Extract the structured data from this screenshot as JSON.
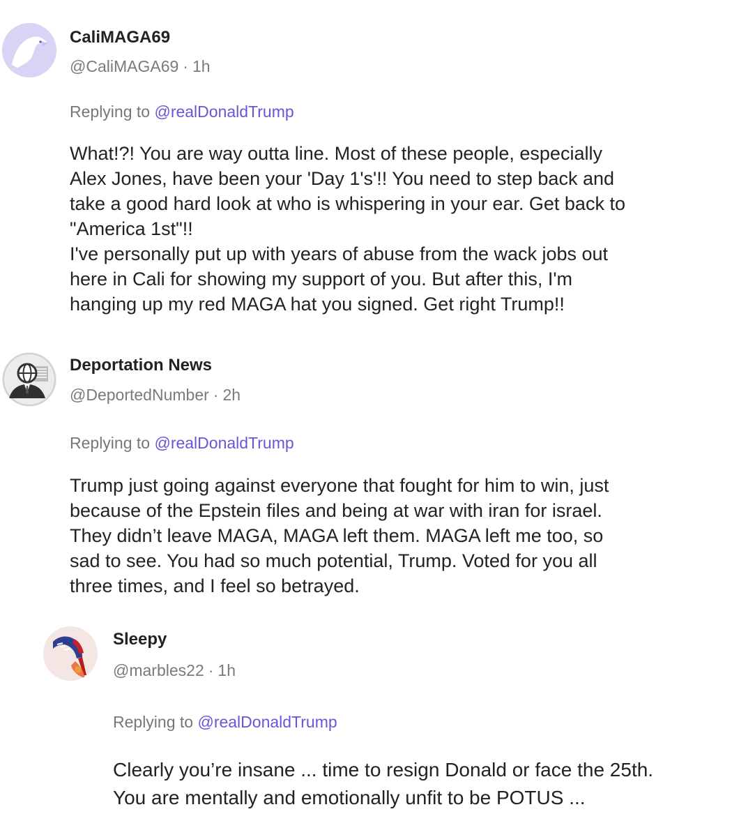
{
  "posts": [
    {
      "display_name": "CaliMAGA69",
      "handle": "@CaliMAGA69",
      "separator": "·",
      "time": "1h",
      "replying_prefix": "Replying to",
      "replying_to": "@realDonaldTrump",
      "avatar_icon": "eagle-avatar-icon",
      "body": "What!?! You are way outta line. Most of these people, especially\nAlex Jones, have been your 'Day 1's'!! You need to step back and\ntake a good hard look at who is whispering in your ear. Get back to\n\"America 1st\"!!\n I've personally put up with years of abuse from the wack jobs out\nhere in Cali for showing my support of you. But after this, I'm\nhanging up my red MAGA hat you signed. Get right Trump!!"
    },
    {
      "display_name": "Deportation News",
      "handle": "@DeportedNumber",
      "separator": "·",
      "time": "2h",
      "replying_prefix": "Replying to",
      "replying_to": "@realDonaldTrump",
      "avatar_icon": "globe-suit-avatar-icon",
      "body": "Trump just going against everyone that fought for him to win, just\nbecause of the Epstein files and being at war with iran for israel.\nThey didn’t leave MAGA, MAGA left them. MAGA left me too, so\nsad to see. You had so much potential, Trump. Voted for you all\nthree times, and I feel so betrayed."
    },
    {
      "display_name": "Sleepy",
      "handle": "@marbles22",
      "separator": "·",
      "time": "1h",
      "replying_prefix": "Replying to",
      "replying_to": "@realDonaldTrump",
      "avatar_icon": "high-heel-avatar-icon",
      "body": "Clearly you’re insane ... time to resign Donald or face the 25th.\nYou are mentally and emotionally unfit to be POTUS ..."
    }
  ],
  "colors": {
    "mention": "#6a55d9",
    "muted": "#7a7a7a",
    "text": "#222222"
  }
}
